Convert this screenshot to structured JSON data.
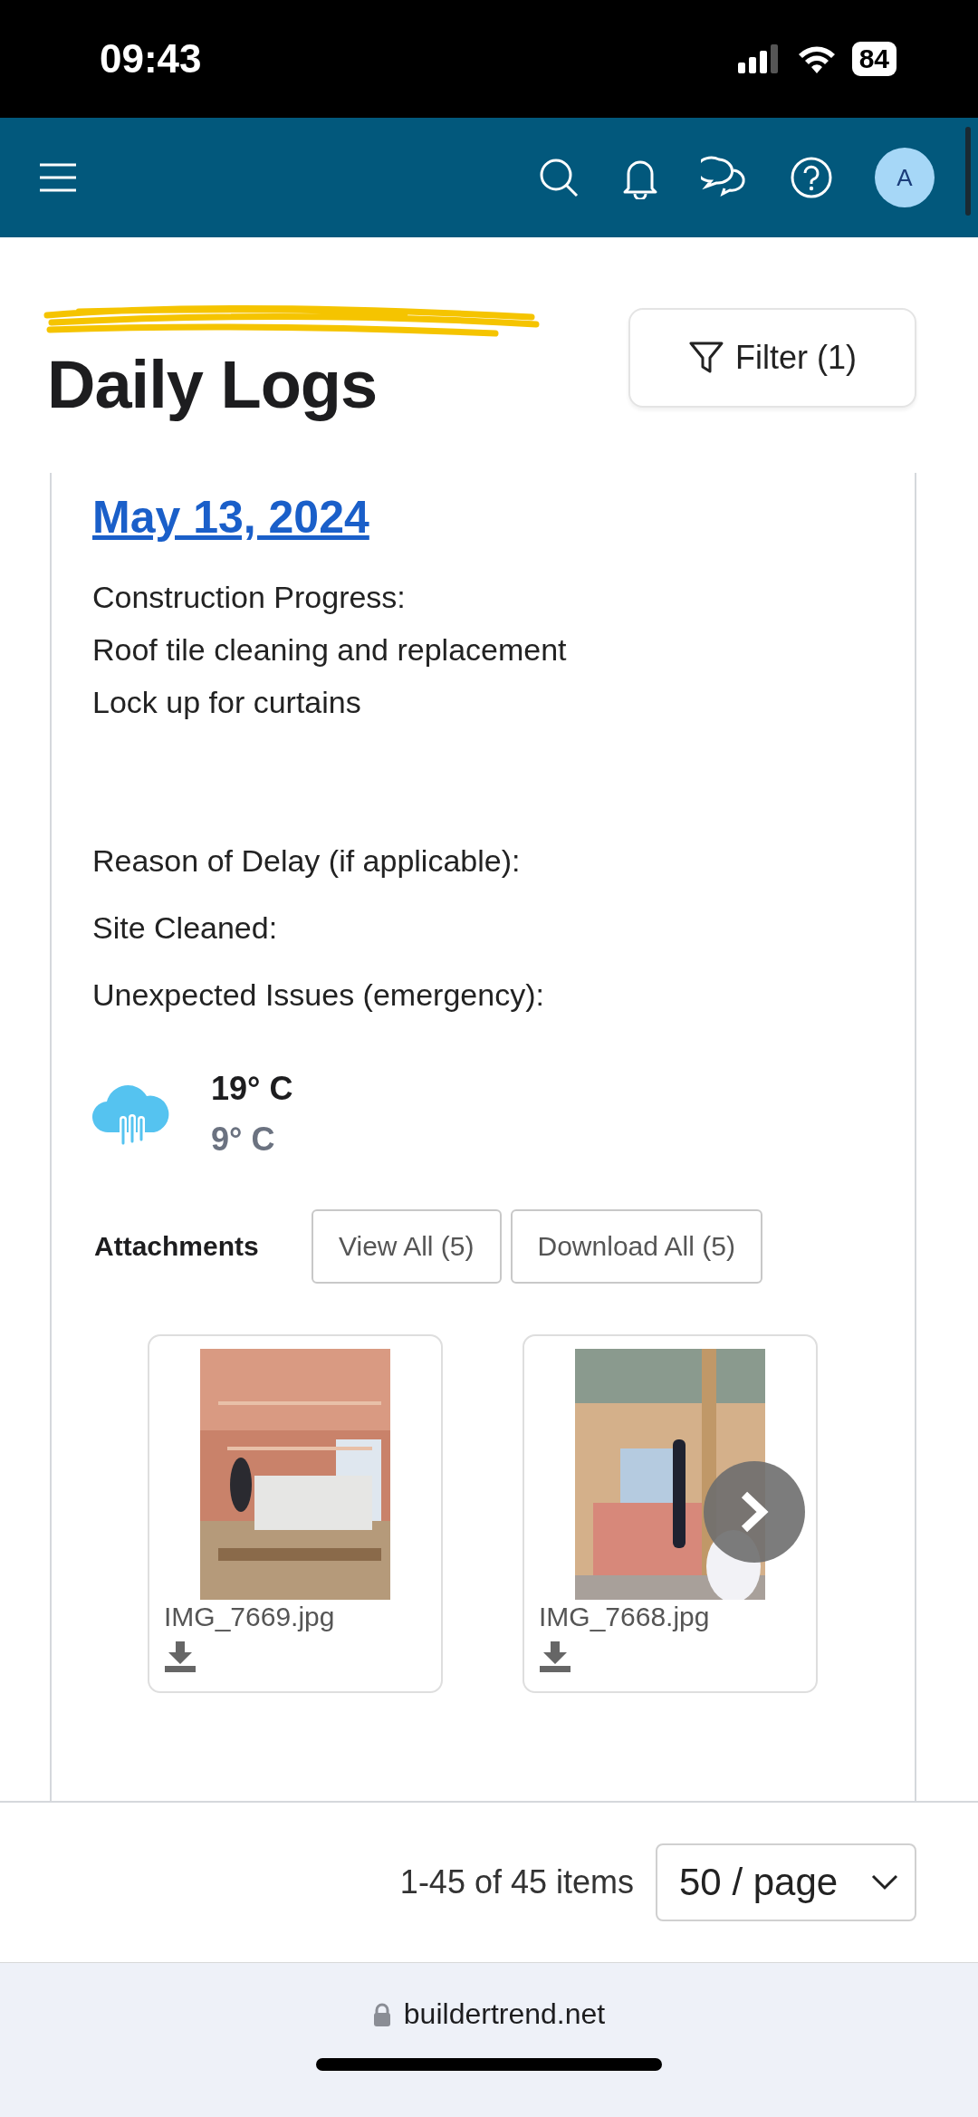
{
  "status_bar": {
    "time": "09:43",
    "battery": "84"
  },
  "nav": {
    "avatar": "A"
  },
  "header": {
    "title": "Daily Logs",
    "filter_button": "Filter (1)"
  },
  "log": {
    "date": "May 13, 2024",
    "paragraphs": [
      {
        "lines": [
          "Construction Progress:",
          "Roof tile cleaning and replacement",
          "Lock up for curtains"
        ]
      },
      {
        "lines": [
          "Reason of Delay (if applicable):"
        ]
      },
      {
        "lines": [
          "Site Cleaned:"
        ]
      },
      {
        "lines": [
          "Unexpected Issues (emergency):"
        ]
      }
    ],
    "weather": {
      "high": "19° C",
      "low": "9° C"
    },
    "attachments": {
      "label": "Attachments",
      "buttons": [
        "View All (5)",
        "Download All (5)"
      ],
      "files": [
        {
          "name": "IMG_7669.jpg",
          "kind": "picture"
        },
        {
          "name": "IMG_7668.jpg",
          "kind": "picture"
        }
      ]
    }
  },
  "pagination": {
    "summary": "1-45 of 45 items",
    "page_size": "50 / page"
  },
  "browser": {
    "url": "buildertrend.net"
  }
}
